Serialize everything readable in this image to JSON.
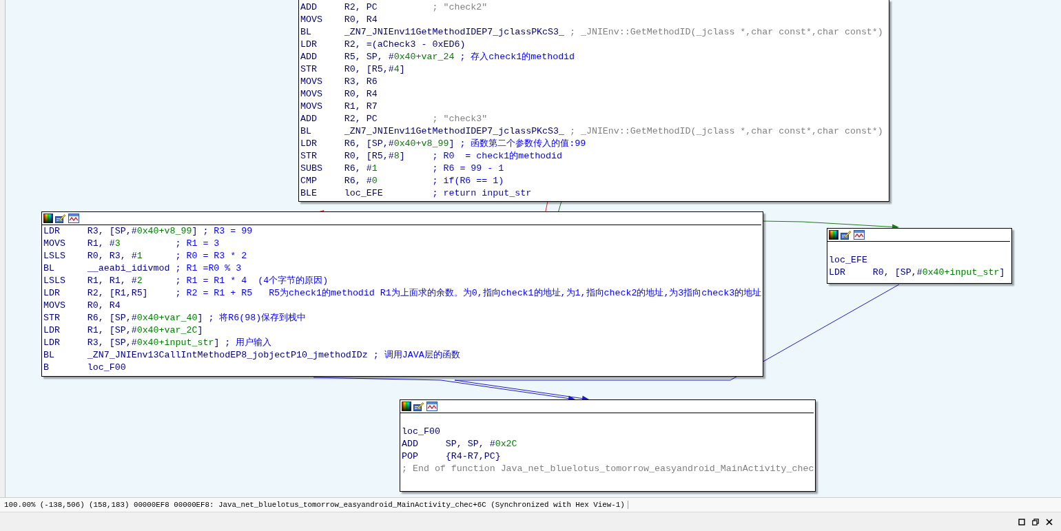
{
  "nodes": [
    {
      "toolbar": false,
      "lines": [
        {
          "kind": "insn",
          "mnemonic": "ADD",
          "operands": "R2, PC",
          "comment": {
            "text": "; \"check2\"",
            "kind": "auto"
          }
        },
        {
          "kind": "insn",
          "mnemonic": "MOVS",
          "operands": "R0, R4"
        },
        {
          "kind": "insn",
          "mnemonic": "BL",
          "operands": "_ZN7_JNIEnv11GetMethodIDEP7_jclassPKcS3_",
          "comment": {
            "text": "; _JNIEnv::GetMethodID(_jclass *,char const*,char const*)",
            "kind": "auto"
          }
        },
        {
          "kind": "insn",
          "mnemonic": "LDR",
          "operands": "R2, =(aCheck3 - 0xED6)"
        },
        {
          "kind": "insn",
          "mnemonic": "ADD",
          "operands": "R5, SP, #0x40+var_24",
          "comment": {
            "text": "; 存入check1的methodid",
            "kind": "user"
          }
        },
        {
          "kind": "insn",
          "mnemonic": "STR",
          "operands": "R0, [R5,#4]"
        },
        {
          "kind": "insn",
          "mnemonic": "MOVS",
          "operands": "R3, R6"
        },
        {
          "kind": "insn",
          "mnemonic": "MOVS",
          "operands": "R0, R4"
        },
        {
          "kind": "insn",
          "mnemonic": "MOVS",
          "operands": "R1, R7"
        },
        {
          "kind": "insn",
          "mnemonic": "ADD",
          "operands": "R2, PC",
          "comment": {
            "text": "; \"check3\"",
            "kind": "auto"
          }
        },
        {
          "kind": "insn",
          "mnemonic": "BL",
          "operands": "_ZN7_JNIEnv11GetMethodIDEP7_jclassPKcS3_",
          "comment": {
            "text": "; _JNIEnv::GetMethodID(_jclass *,char const*,char const*)",
            "kind": "auto"
          }
        },
        {
          "kind": "insn",
          "mnemonic": "LDR",
          "operands": "R6, [SP,#0x40+v8_99]",
          "comment": {
            "text": "; 函数第二个参数传入的值:99",
            "kind": "user"
          }
        },
        {
          "kind": "insn",
          "mnemonic": "STR",
          "operands": "R0, [R5,#8]",
          "comment": {
            "text": "; R0  = check1的methodid",
            "kind": "user"
          }
        },
        {
          "kind": "insn",
          "mnemonic": "SUBS",
          "operands": "R6, #1",
          "comment": {
            "text": "; R6 = 99 - 1",
            "kind": "user"
          }
        },
        {
          "kind": "insn",
          "mnemonic": "CMP",
          "operands": "R6, #0",
          "comment": {
            "text": "; if(R6 == 1)",
            "kind": "user"
          }
        },
        {
          "kind": "insn",
          "mnemonic": "BLE",
          "operands": "loc_EFE",
          "comment": {
            "text": "; return input_str",
            "kind": "user"
          }
        }
      ]
    },
    {
      "toolbar": true,
      "lines": [
        {
          "kind": "insn",
          "mnemonic": "LDR",
          "operands": "R3, [SP,#0x40+v8_99]",
          "comment": {
            "text": "; R3 = 99",
            "kind": "user"
          }
        },
        {
          "kind": "insn",
          "mnemonic": "MOVS",
          "operands": "R1, #3",
          "comment": {
            "text": "; R1 = 3",
            "kind": "user"
          }
        },
        {
          "kind": "insn",
          "mnemonic": "LSLS",
          "operands": "R0, R3, #1",
          "comment": {
            "text": "; R0 = R3 * 2",
            "kind": "user"
          }
        },
        {
          "kind": "insn",
          "mnemonic": "BL",
          "operands": "__aeabi_idivmod",
          "comment": {
            "text": "; R1 =R0 % 3",
            "kind": "user"
          }
        },
        {
          "kind": "insn",
          "mnemonic": "LSLS",
          "operands": "R1, R1, #2",
          "comment": {
            "text": "; R1 = R1 * 4  (4个字节的原因)",
            "kind": "user"
          }
        },
        {
          "kind": "insn",
          "mnemonic": "LDR",
          "operands": "R2, [R1,R5]",
          "comment": {
            "text": "; R2 = R1 + R5   R5为check1的methodid R1为上面求的余数。为0,指向check1的地址,为1,指向check2的地址,为3指向check3的地址",
            "kind": "user"
          }
        },
        {
          "kind": "insn",
          "mnemonic": "MOVS",
          "operands": "R0, R4"
        },
        {
          "kind": "insn",
          "mnemonic": "STR",
          "operands": "R6, [SP,#0x40+var_40]",
          "comment": {
            "text": "; 将R6(98)保存到栈中",
            "kind": "user"
          }
        },
        {
          "kind": "insn",
          "mnemonic": "LDR",
          "operands": "R1, [SP,#0x40+var_2C]"
        },
        {
          "kind": "insn",
          "mnemonic": "LDR",
          "operands": "R3, [SP,#0x40+input_str]",
          "comment": {
            "text": "; 用户输入",
            "kind": "user"
          }
        },
        {
          "kind": "insn",
          "mnemonic": "BL",
          "operands": "_ZN7_JNIEnv13CallIntMethodEP8_jobjectP10_jmethodIDz",
          "comment": {
            "text": "; 调用JAVA层的函数",
            "kind": "user"
          }
        },
        {
          "kind": "insn",
          "mnemonic": "B",
          "operands": "loc_F00"
        }
      ]
    },
    {
      "toolbar": true,
      "lines": [
        {
          "kind": "label",
          "text": "loc_EFE"
        },
        {
          "kind": "insn",
          "mnemonic": "LDR",
          "operands": "R0, [SP,#0x40+input_str]"
        }
      ]
    },
    {
      "toolbar": true,
      "lines": [
        {
          "kind": "label",
          "text": "loc_F00"
        },
        {
          "kind": "insn",
          "mnemonic": "ADD",
          "operands": "SP, SP, #0x2C"
        },
        {
          "kind": "insn",
          "mnemonic": "POP",
          "operands": "{R4-R7,PC}"
        },
        {
          "kind": "note",
          "text": "; End of function Java_net_bluelotus_tomorrow_easyandroid_MainActivity_chec"
        }
      ]
    }
  ],
  "status_bar": {
    "text": "100.00% (-138,506) (158,183) 00000EF8 00000EF8: Java_net_bluelotus_tomorrow_easyandroid_MainActivity_chec+6C (Synchronized with Hex View-1)"
  }
}
